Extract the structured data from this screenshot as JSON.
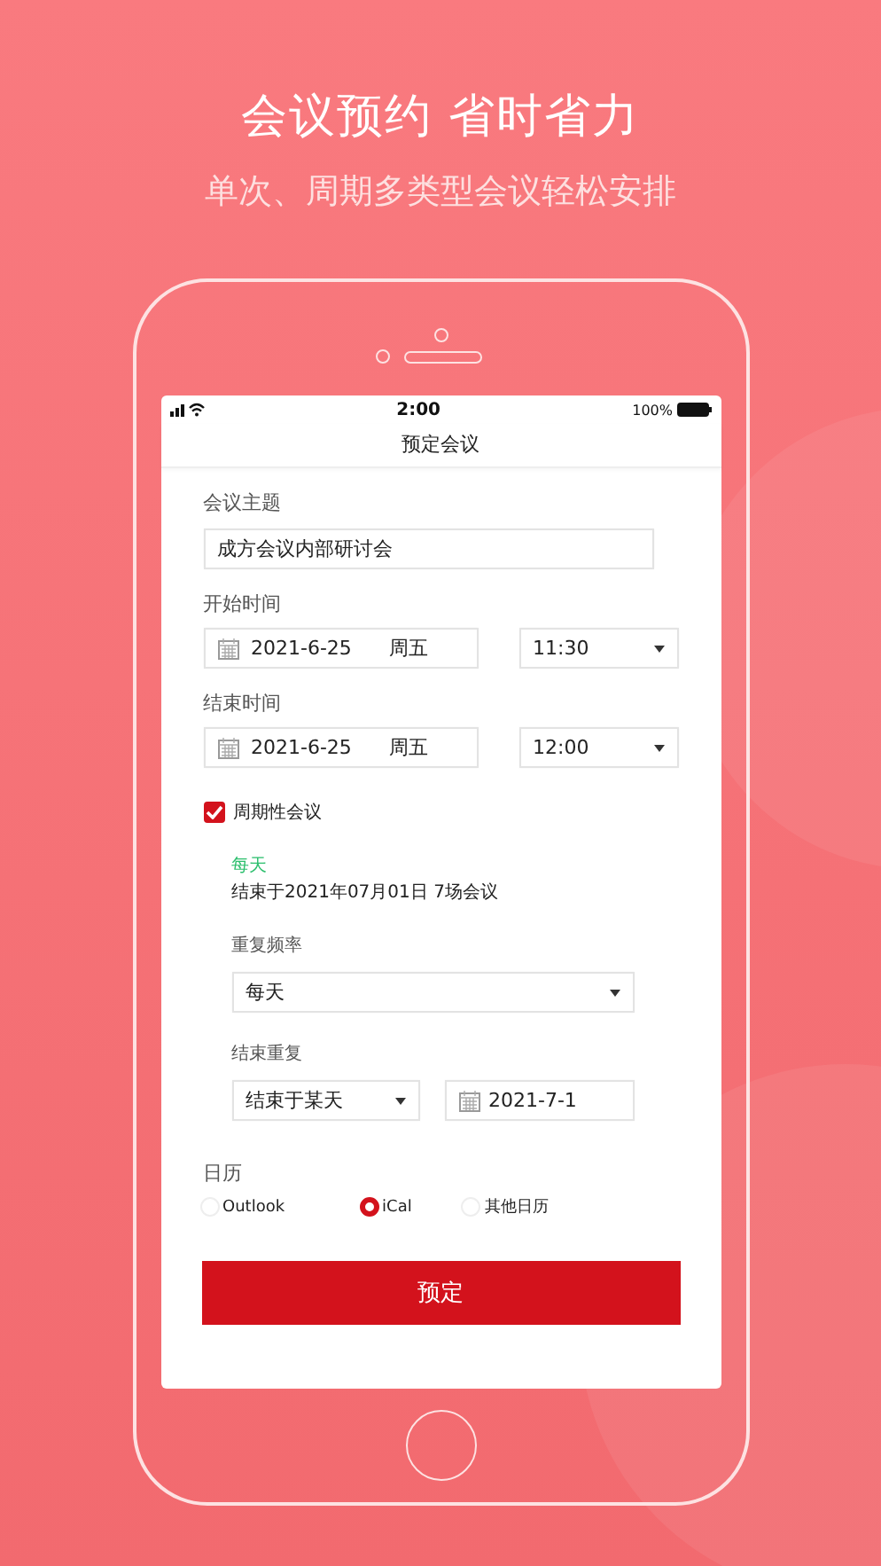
{
  "headline": "会议预约 省时省力",
  "subtitle": "单次、周期多类型会议轻松安排",
  "status_bar": {
    "time": "2:00",
    "battery": "100%"
  },
  "nav_title": "预定会议",
  "topic": {
    "label": "会议主题",
    "value": "成方会议内部研讨会"
  },
  "start": {
    "label": "开始时间",
    "date": "2021-6-25",
    "weekday": "周五",
    "time": "11:30"
  },
  "end": {
    "label": "结束时间",
    "date": "2021-6-25",
    "weekday": "周五",
    "time": "12:00"
  },
  "recurring": {
    "label": "周期性会议",
    "checked": true,
    "frequency_summary": "每天",
    "end_summary": "结束于2021年07月01日 7场会议",
    "frequency": {
      "label": "重复频率",
      "value": "每天"
    },
    "end_repeat": {
      "label": "结束重复",
      "mode": "结束于某天",
      "date": "2021-7-1"
    }
  },
  "calendar": {
    "label": "日历",
    "options": [
      {
        "label": "Outlook",
        "selected": false
      },
      {
        "label": "iCal",
        "selected": true
      },
      {
        "label": "其他日历",
        "selected": false
      }
    ]
  },
  "submit": "预定"
}
